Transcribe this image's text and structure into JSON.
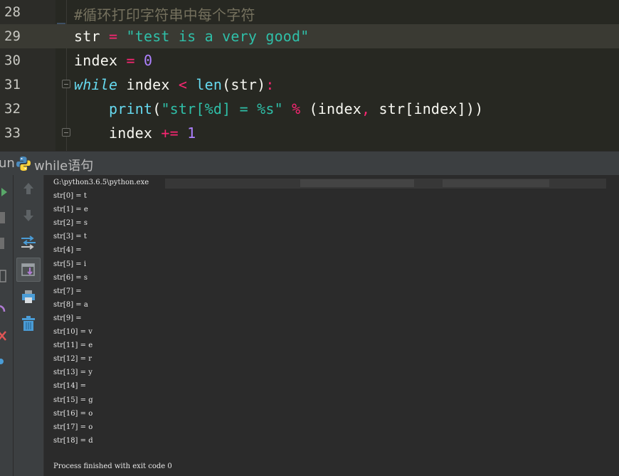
{
  "editor": {
    "lines": [
      {
        "num": "28",
        "tokens": [
          {
            "t": "#循环打印字符串中每个字符",
            "c": "cm"
          }
        ]
      },
      {
        "num": "29",
        "tokens": [
          {
            "t": "str",
            "c": ""
          },
          {
            "t": " = ",
            "c": "op"
          },
          {
            "t": "\"test is a very good\"",
            "c": "str-t"
          }
        ]
      },
      {
        "num": "30",
        "tokens": [
          {
            "t": "index",
            "c": ""
          },
          {
            "t": " = ",
            "c": "op"
          },
          {
            "t": "0",
            "c": "num-lit"
          }
        ]
      },
      {
        "num": "31",
        "tokens": [
          {
            "t": "while",
            "c": "kw"
          },
          {
            "t": " index ",
            "c": ""
          },
          {
            "t": "<",
            "c": "op"
          },
          {
            "t": " ",
            "c": ""
          },
          {
            "t": "len",
            "c": "fn"
          },
          {
            "t": "(str)",
            "c": ""
          },
          {
            "t": ":",
            "c": "op"
          }
        ]
      },
      {
        "num": "32",
        "tokens": [
          {
            "t": "    ",
            "c": ""
          },
          {
            "t": "print",
            "c": "fn"
          },
          {
            "t": "(",
            "c": ""
          },
          {
            "t": "\"str[%d] = %s\"",
            "c": "str-t"
          },
          {
            "t": " ",
            "c": ""
          },
          {
            "t": "%",
            "c": "op"
          },
          {
            "t": " (index",
            "c": ""
          },
          {
            "t": ",",
            "c": "op"
          },
          {
            "t": " str[index]))",
            "c": ""
          }
        ]
      },
      {
        "num": "33",
        "tokens": [
          {
            "t": "    index ",
            "c": ""
          },
          {
            "t": "+=",
            "c": "op"
          },
          {
            "t": " ",
            "c": ""
          },
          {
            "t": "1",
            "c": "num-lit"
          }
        ]
      }
    ]
  },
  "run_panel": {
    "label": "un",
    "config_name": "while语句"
  },
  "toolbar": {
    "icons": [
      "arrow-up-icon",
      "arrow-down-icon",
      "soft-wrap-icon",
      "scroll-to-end-icon",
      "print-icon",
      "trash-icon"
    ]
  },
  "console": {
    "command": "G:\\python3.6.5\\python.exe",
    "output": [
      "str[0] = t",
      "str[1] = e",
      "str[2] = s",
      "str[3] = t",
      "str[4] =  ",
      "str[5] = i",
      "str[6] = s",
      "str[7] =  ",
      "str[8] = a",
      "str[9] =  ",
      "str[10] = v",
      "str[11] = e",
      "str[12] = r",
      "str[13] = y",
      "str[14] =  ",
      "str[15] = g",
      "str[16] = o",
      "str[17] = o",
      "str[18] = d"
    ],
    "exit_message": "Process finished with exit code 0"
  },
  "colors": {
    "editor_bg": "#272822",
    "console_bg": "#2b2b2b",
    "toolbar_bg": "#3c3f41",
    "keyword": "#66d9ef",
    "string": "#2fbfa8",
    "operator": "#f92672",
    "number": "#ae81ff",
    "comment": "#75715e"
  }
}
